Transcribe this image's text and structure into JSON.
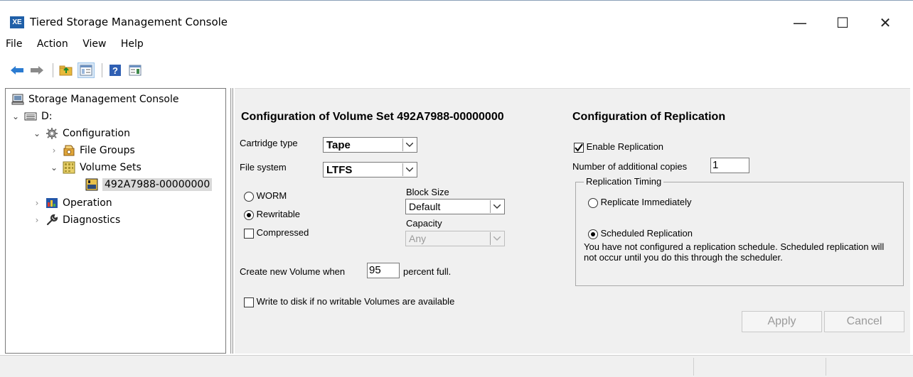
{
  "window": {
    "app_icon_text": "XE",
    "title": "Tiered Storage Management Console",
    "minimize_glyph": "—",
    "maximize_glyph": "☐",
    "close_glyph": "✕"
  },
  "menu": [
    "File",
    "Action",
    "View",
    "Help"
  ],
  "toolbar": {
    "icons": [
      "back-arrow-icon",
      "forward-arrow-icon",
      "up-folder-icon",
      "show-hide-tree-icon",
      "help-icon",
      "action-pane-icon"
    ]
  },
  "tree": {
    "root": "Storage Management Console",
    "drive": "D:",
    "configuration": "Configuration",
    "file_groups": "File Groups",
    "volume_sets": "Volume Sets",
    "volume_set_item": "492A7988-00000000",
    "operation": "Operation",
    "diagnostics": "Diagnostics"
  },
  "volume_config": {
    "title": "Configuration of Volume Set 492A7988-00000000",
    "cartridge_type_label": "Cartridge type",
    "cartridge_type_value": "Tape",
    "file_system_label": "File system",
    "file_system_value": "LTFS",
    "worm_label": "WORM",
    "worm_selected": false,
    "rewritable_label": "Rewritable",
    "rewritable_selected": true,
    "compressed_label": "Compressed",
    "compressed_checked": false,
    "block_size_label": "Block Size",
    "block_size_value": "Default",
    "capacity_label": "Capacity",
    "capacity_value": "Any",
    "create_new_prefix": "Create new Volume when",
    "create_new_value": "95",
    "create_new_suffix": "percent full.",
    "write_to_disk_label": "Write to disk if no writable Volumes are available",
    "write_to_disk_checked": false
  },
  "replication": {
    "title": "Configuration of Replication",
    "enable_label": "Enable Replication",
    "enable_checked": true,
    "copies_label": "Number of additional copies",
    "copies_value": "1",
    "timing_group_title": "Replication Timing",
    "immediately_label": "Replicate Immediately",
    "immediately_selected": false,
    "scheduled_label": "Scheduled Replication",
    "scheduled_selected": true,
    "note": "You have not configured a replication schedule. Scheduled replication will not occur until you do this through the scheduler."
  },
  "buttons": {
    "apply": "Apply",
    "cancel": "Cancel"
  },
  "colors": {
    "app_icon_blue": "#1f5fa8",
    "panel_bg": "#f0f0f0",
    "selection_gray": "#d9d9d9",
    "disabled_text": "#9a9a9a"
  }
}
